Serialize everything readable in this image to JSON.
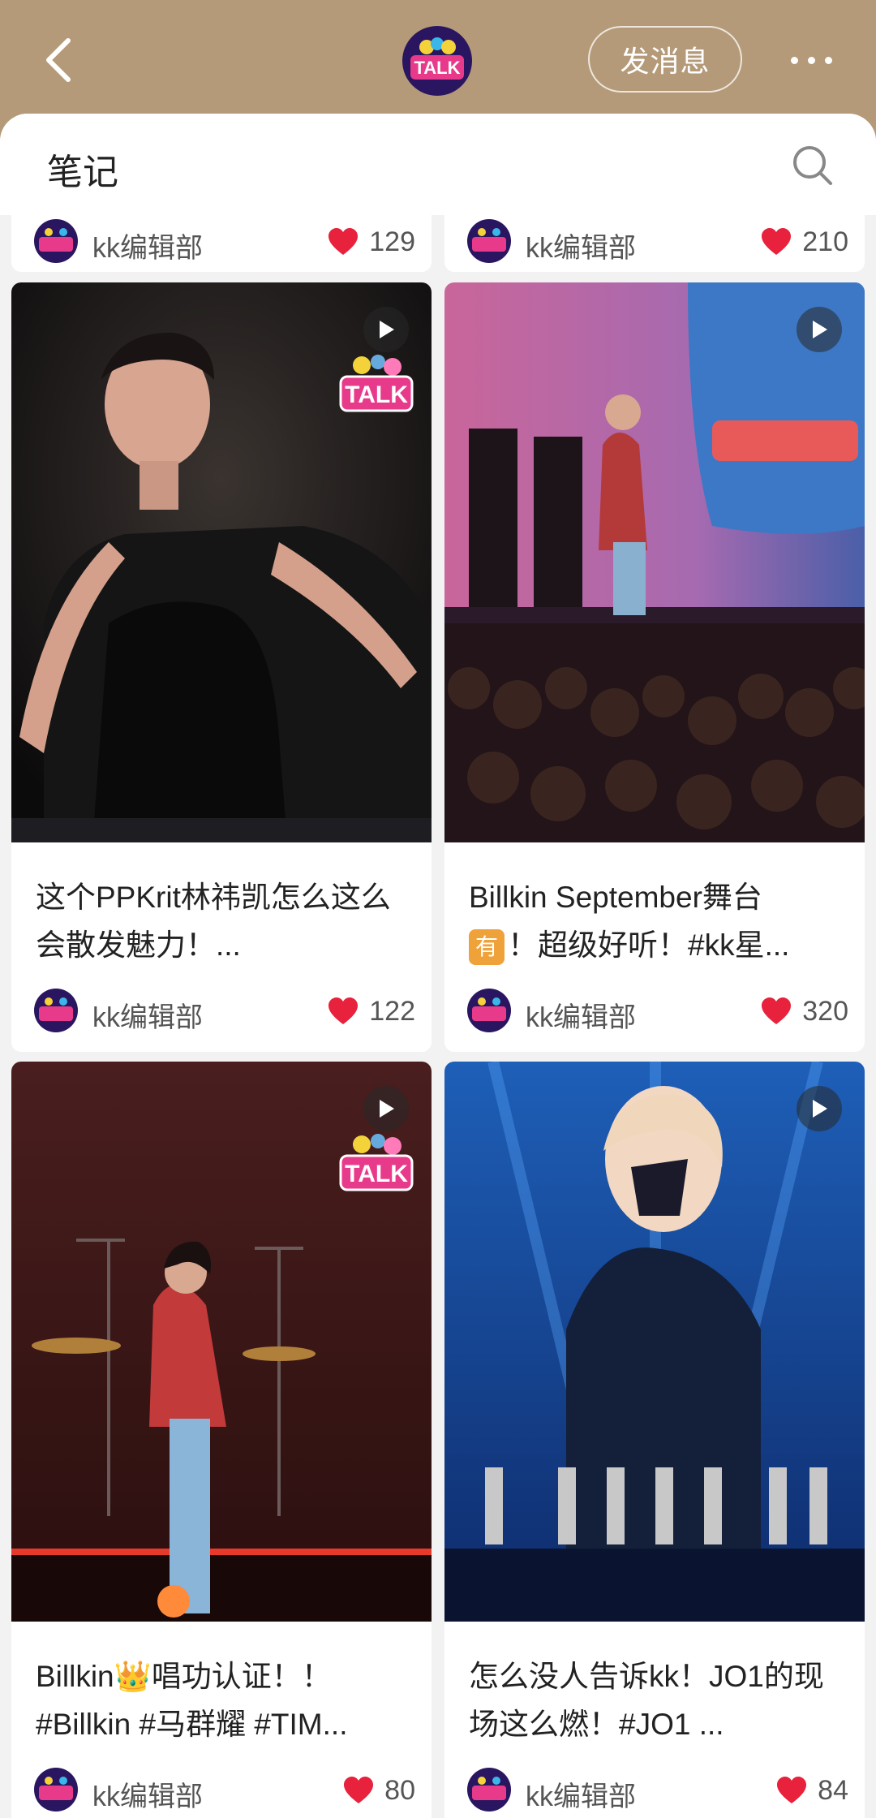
{
  "header": {
    "send_message_label": "发消息",
    "logo_text": "TALK"
  },
  "sheet": {
    "title": "笔记"
  },
  "partial_row": [
    {
      "author": "kk编辑部",
      "likes": "129"
    },
    {
      "author": "kk编辑部",
      "likes": "210"
    }
  ],
  "notes": [
    {
      "title": "这个PPKrit林祎凯怎么这么会散发魅力！...",
      "author": "kk编辑部",
      "likes": "122",
      "sticker": "TALK"
    },
    {
      "title_tag": "有",
      "title_pre": "Billkin September舞台",
      "title_post": "！超级好听！#kk星...",
      "author": "kk编辑部",
      "likes": "320"
    },
    {
      "title_pre": "Billkin",
      "title_emoji": "👑",
      "title_post": "唱功认证！！#Billkin #马群耀 #TIM...",
      "author": "kk编辑部",
      "likes": "80",
      "sticker": "TALK"
    },
    {
      "title": "怎么没人告诉kk！JO1的现场这么燃！#JO1 ...",
      "author": "kk编辑部",
      "likes": "84"
    }
  ],
  "colors": {
    "header_bg": "#b49a78",
    "heart": "#e8213c",
    "tag": "#f0a23a"
  }
}
